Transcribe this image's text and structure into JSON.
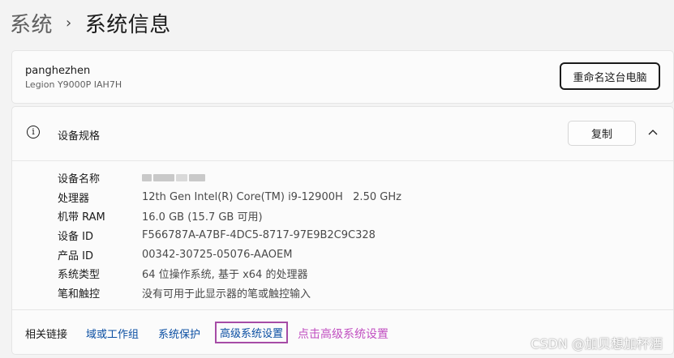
{
  "breadcrumb": {
    "parent": "系统",
    "separator": "›",
    "current": "系统信息"
  },
  "device": {
    "name": "panghezhen",
    "model": "Legion Y9000P IAH7H",
    "rename_label": "重命名这台电脑"
  },
  "specs": {
    "title": "设备规格",
    "copy_label": "复制",
    "rows": [
      {
        "label": "设备名称",
        "value": ""
      },
      {
        "label": "处理器",
        "value": "12th Gen Intel(R) Core(TM) i9-12900H   2.50 GHz"
      },
      {
        "label": "机带 RAM",
        "value": "16.0 GB (15.7 GB 可用)"
      },
      {
        "label": "设备 ID",
        "value": "F566787A-A7BF-4DC5-8717-97E9B2C9C328"
      },
      {
        "label": "产品 ID",
        "value": "00342-30725-05076-AAOEM"
      },
      {
        "label": "系统类型",
        "value": "64 位操作系统, 基于 x64 的处理器"
      },
      {
        "label": "笔和触控",
        "value": "没有可用于此显示器的笔或触控输入"
      }
    ]
  },
  "related": {
    "label": "相关链接",
    "links": [
      "域或工作组",
      "系统保护",
      "高级系统设置"
    ],
    "annotation": "点击高级系统设置"
  },
  "watermark": "CSDN @加贝想加杯酒",
  "icons": {
    "info": "info-icon",
    "collapse": "chevron-up-icon"
  }
}
